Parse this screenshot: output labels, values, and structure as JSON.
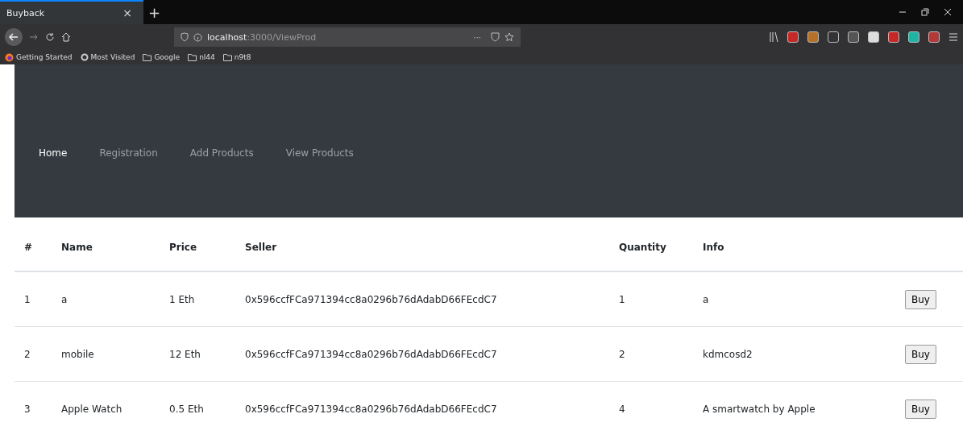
{
  "browser": {
    "tab_title": "Buyback",
    "tab_close": "×",
    "new_tab": "+",
    "url_host": "localhost",
    "url_path": ":3000/ViewProd",
    "page_actions": "···",
    "bookmarks": [
      {
        "kind": "special",
        "label": "Getting Started"
      },
      {
        "kind": "special",
        "label": "Most Visited"
      },
      {
        "kind": "folder",
        "label": "Google"
      },
      {
        "kind": "folder",
        "label": "nl44"
      },
      {
        "kind": "folder",
        "label": "n9t8"
      }
    ]
  },
  "navbar": {
    "items": [
      {
        "label": "Home",
        "selected": true
      },
      {
        "label": "Registration",
        "selected": false
      },
      {
        "label": "Add Products",
        "selected": false
      },
      {
        "label": "View Products",
        "selected": false
      }
    ]
  },
  "table": {
    "columns": [
      "#",
      "Name",
      "Price",
      "Seller",
      "Quantity",
      "Info"
    ],
    "rows": [
      {
        "index": "1",
        "name": "a",
        "price": "1 Eth",
        "seller": "0x596ccfFCa971394cc8a0296b76dAdabD66FEcdC7",
        "quantity": "1",
        "info": "a",
        "action": "Buy"
      },
      {
        "index": "2",
        "name": "mobile",
        "price": "12 Eth",
        "seller": "0x596ccfFCa971394cc8a0296b76dAdabD66FEcdC7",
        "quantity": "2",
        "info": "kdmcosd2",
        "action": "Buy"
      },
      {
        "index": "3",
        "name": "Apple Watch",
        "price": "0.5 Eth",
        "seller": "0x596ccfFCa971394cc8a0296b76dAdabD66FEcdC7",
        "quantity": "4",
        "info": "A smartwatch by Apple",
        "action": "Buy"
      }
    ]
  }
}
